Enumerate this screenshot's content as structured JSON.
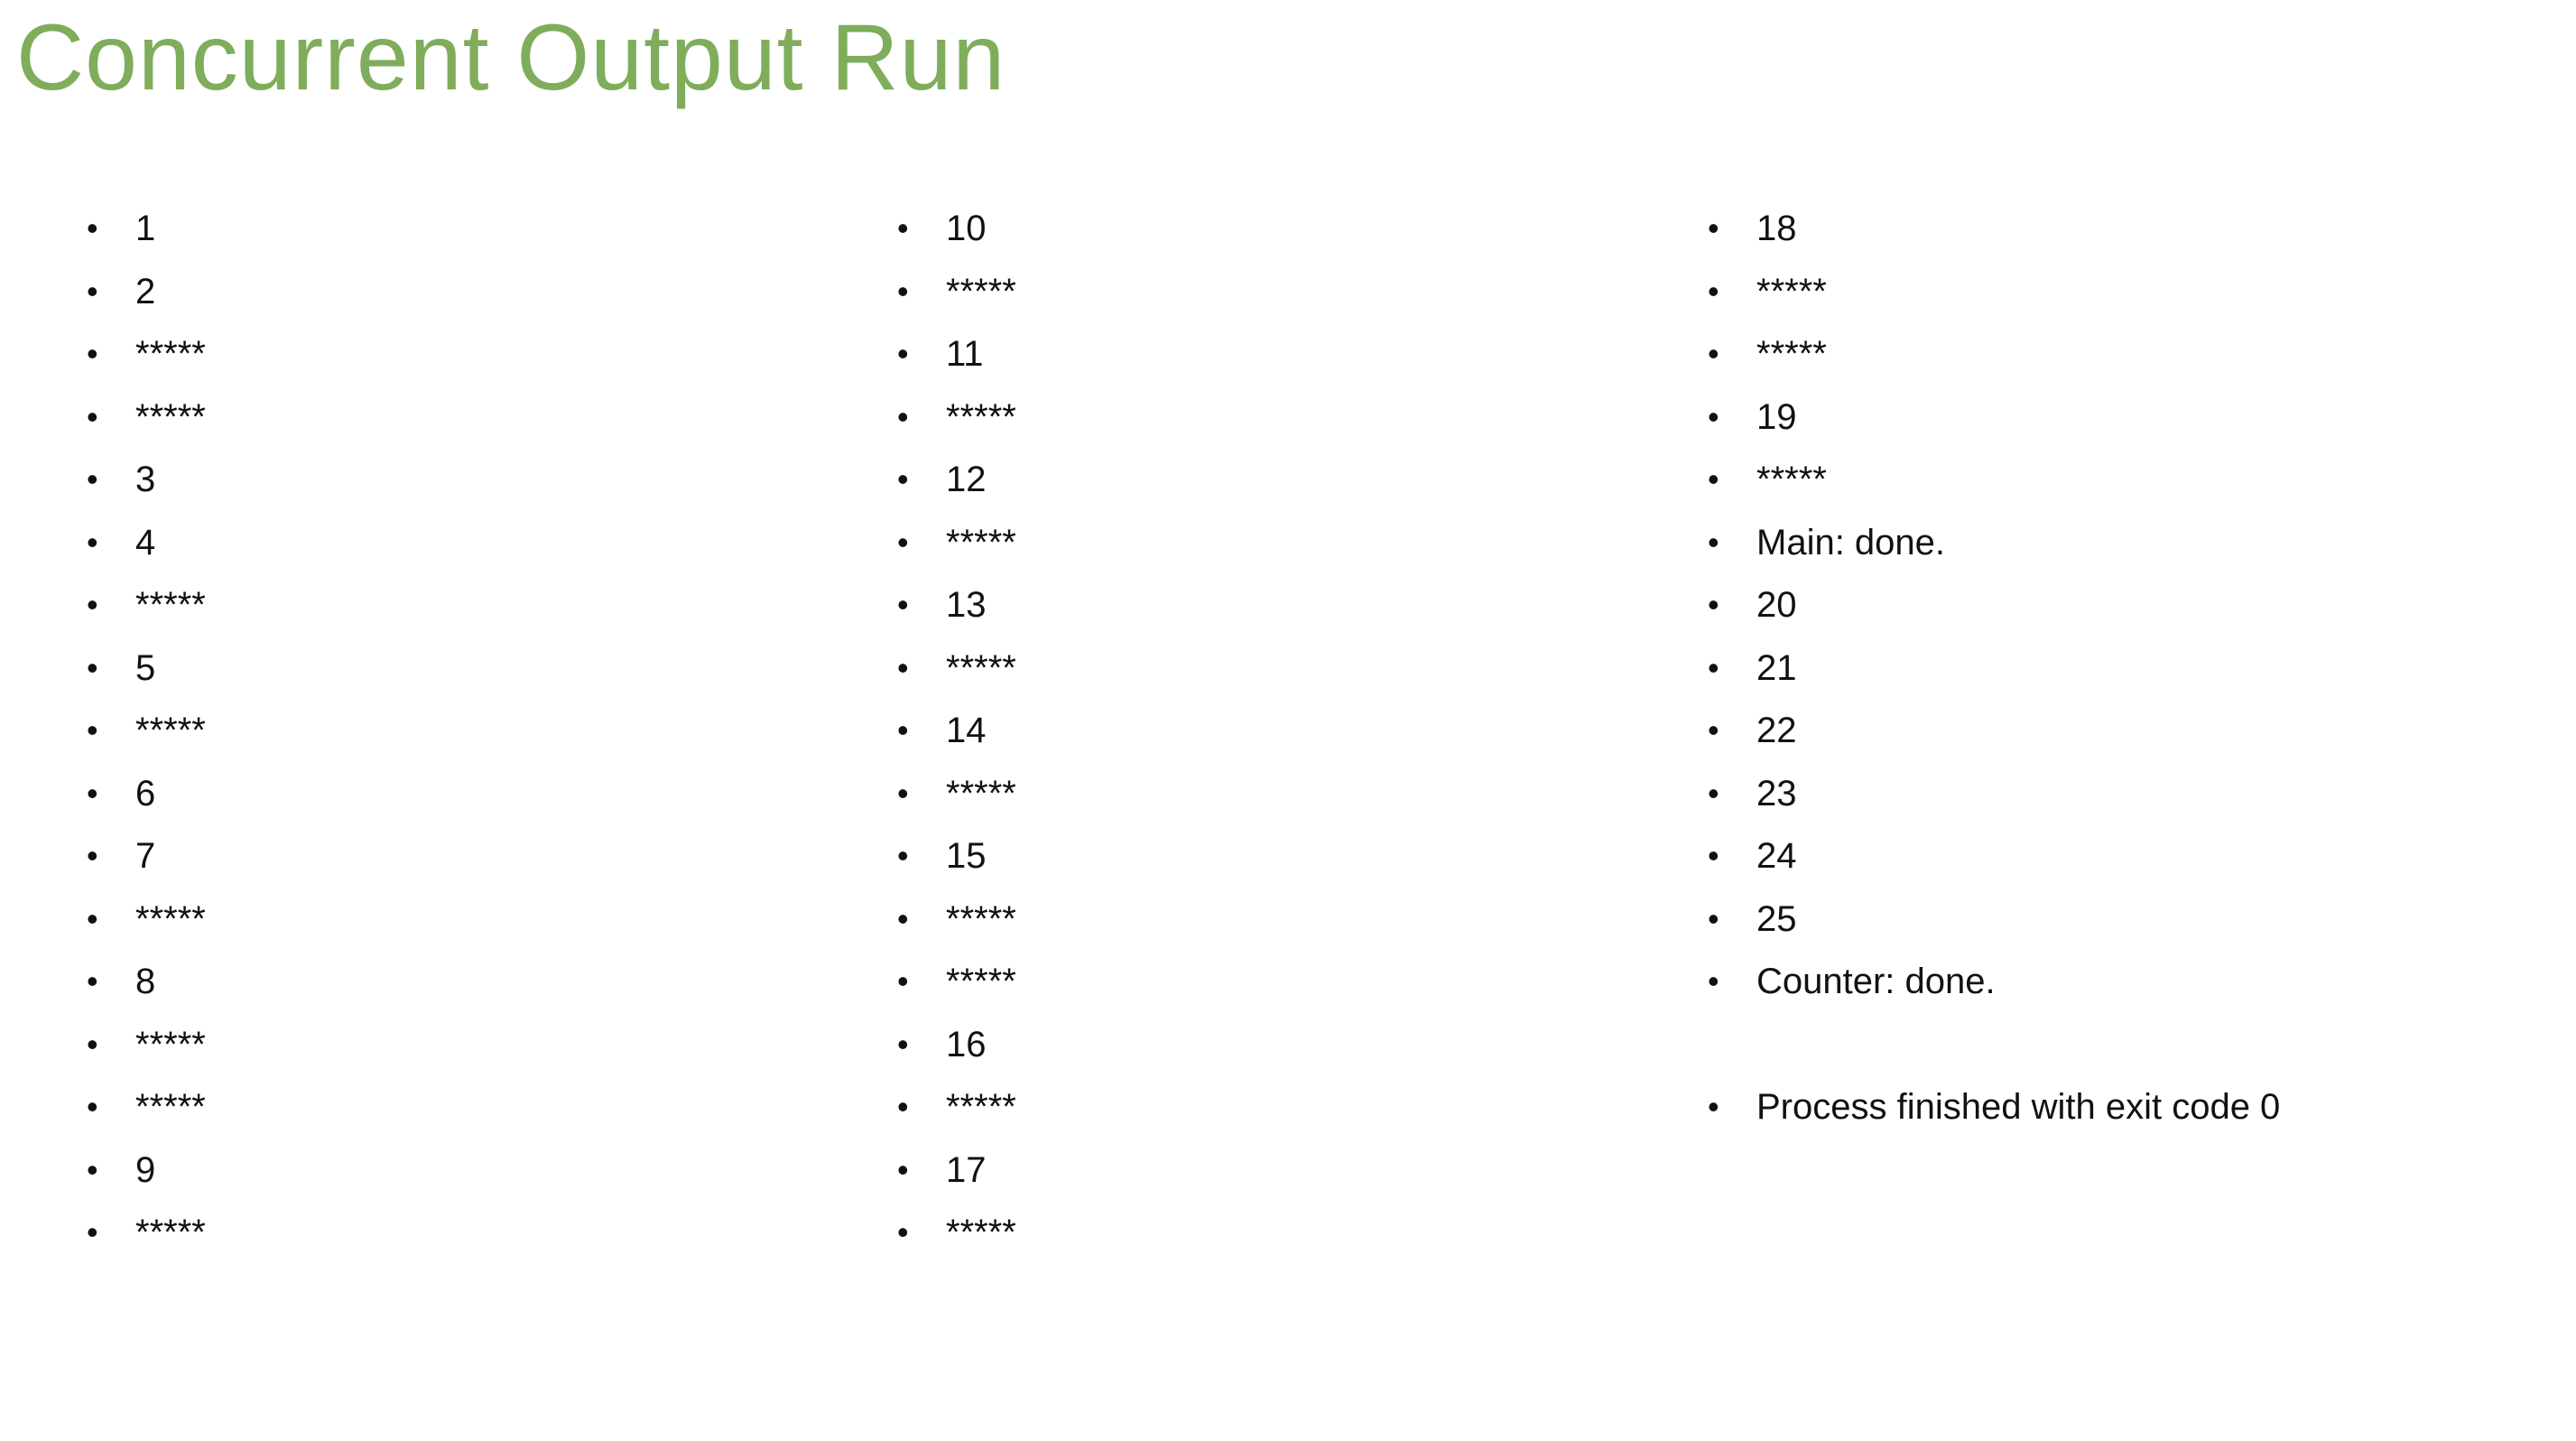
{
  "title": "Concurrent Output Run",
  "columns": [
    [
      "1",
      "2",
      "*****",
      "*****",
      "3",
      "4",
      "*****",
      "5",
      "*****",
      "6",
      "7",
      "*****",
      "8",
      "*****",
      "*****",
      "9",
      "*****"
    ],
    [
      "10",
      "*****",
      "11",
      "*****",
      "12",
      "*****",
      "13",
      "*****",
      "14",
      "*****",
      "15",
      "*****",
      "*****",
      "16",
      "*****",
      "17",
      "*****"
    ],
    [
      "18",
      "*****",
      "*****",
      "19",
      "*****",
      "Main: done.",
      "20",
      "21",
      "22",
      "23",
      "24",
      "25",
      "Counter: done.",
      "Process finished with exit code 0"
    ]
  ],
  "colors": {
    "title": "#7fad5b",
    "text": "#111111",
    "background": "#ffffff"
  }
}
